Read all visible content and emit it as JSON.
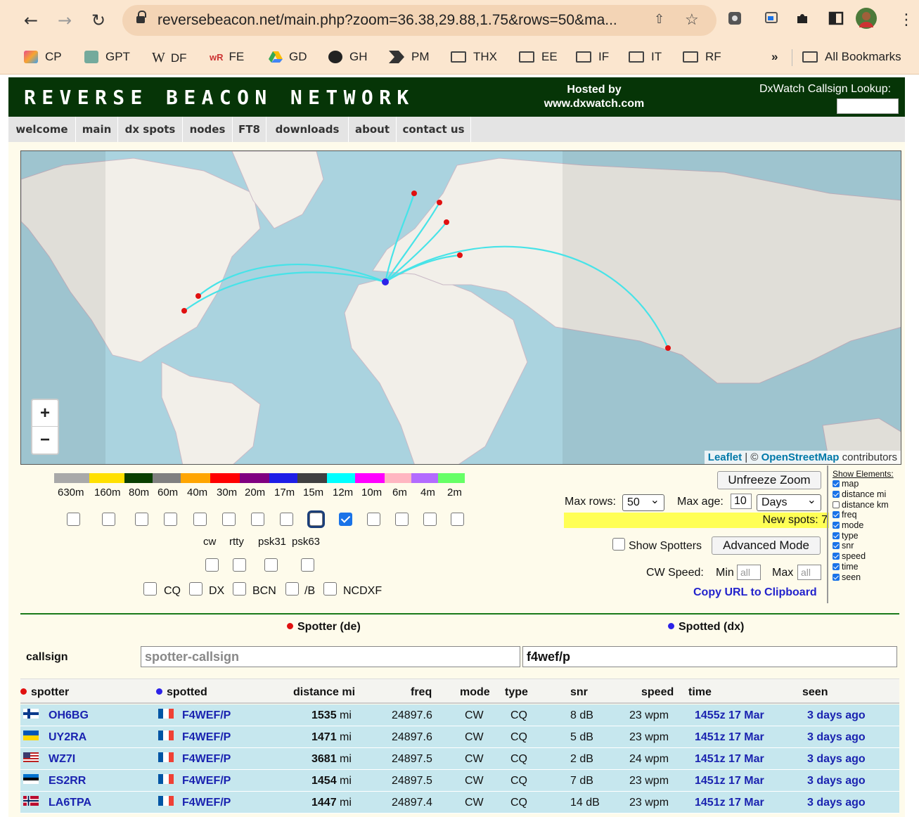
{
  "browser": {
    "url": "reversebeacon.net/main.php?zoom=36.38,29.88,1.75&rows=50&ma...",
    "bookmarks": [
      "CP",
      "GPT",
      "DF",
      "FE",
      "GD",
      "GH",
      "PM",
      "THX",
      "EE",
      "IF",
      "IT",
      "RF"
    ],
    "all_bookmarks": "All Bookmarks",
    "overflow": "»"
  },
  "banner": {
    "logo": "REVERSE BEACON NETWORK",
    "hosted_line1": "Hosted by",
    "hosted_line2": "www.dxwatch.com",
    "lookup_label": "DxWatch Callsign Lookup:"
  },
  "nav": [
    "welcome",
    "main",
    "dx spots",
    "nodes",
    "FT8",
    "downloads",
    "about",
    "contact us"
  ],
  "map": {
    "zoom_in": "+",
    "zoom_out": "−",
    "attrib_leaflet": "Leaflet",
    "attrib_sep": " | © ",
    "attrib_osm": "OpenStreetMap",
    "attrib_tail": " contributors"
  },
  "bands": {
    "labels": [
      "630m",
      "160m",
      "80m",
      "60m",
      "40m",
      "30m",
      "20m",
      "17m",
      "15m",
      "12m",
      "10m",
      "6m",
      "4m",
      "2m"
    ],
    "colors": [
      "#a9a9a9",
      "#ffe000",
      "#093f00",
      "#808080",
      "#ffa500",
      "#ff0000",
      "#800080",
      "#1e1ee6",
      "#404040",
      "#00ffff",
      "#ff00ff",
      "#ffb6c1",
      "#b36bff",
      "#66ff66"
    ],
    "checked": [
      false,
      false,
      false,
      false,
      false,
      false,
      false,
      false,
      false,
      true,
      false,
      false,
      false,
      false
    ]
  },
  "modes": [
    "cw",
    "rtty",
    "psk31",
    "psk63"
  ],
  "spot_types": [
    "CQ",
    "DX",
    "BCN",
    "/B",
    "NCDXF"
  ],
  "controls": {
    "unfreeze": "Unfreeze Zoom",
    "max_rows_label": "Max rows:",
    "max_rows": "50",
    "max_age_label": "Max age:",
    "max_age": "10",
    "max_age_unit": "Days",
    "new_spots": "New spots: 7",
    "show_spotters": "Show Spotters",
    "advanced": "Advanced Mode",
    "cw_speed": "CW Speed:",
    "min": "Min",
    "max": "Max",
    "all": "all",
    "copy_url": "Copy URL to Clipboard"
  },
  "show_elements": {
    "title": "Show Elements:",
    "items": [
      {
        "label": "map",
        "on": true
      },
      {
        "label": "distance mi",
        "on": true
      },
      {
        "label": "distance km",
        "on": false
      },
      {
        "label": "freq",
        "on": true
      },
      {
        "label": "mode",
        "on": true
      },
      {
        "label": "type",
        "on": true
      },
      {
        "label": "snr",
        "on": true
      },
      {
        "label": "speed",
        "on": true
      },
      {
        "label": "time",
        "on": true
      },
      {
        "label": "seen",
        "on": true
      }
    ]
  },
  "filter": {
    "spotter_head": "Spotter (de)",
    "spotted_head": "Spotted (dx)",
    "callsign_label": "callsign",
    "spotter_placeholder": "spotter-callsign",
    "spotted_value": "f4wef/p"
  },
  "table": {
    "headers": [
      "spotter",
      "spotted",
      "distance mi",
      "freq",
      "mode",
      "type",
      "snr",
      "speed",
      "time",
      "seen"
    ],
    "rows": [
      {
        "spotter": "OH6BG",
        "flag": "fi",
        "spotted": "F4WEF/P",
        "dist": "1535",
        "unit": "mi",
        "freq": "24897.6",
        "mode": "CW",
        "type": "CQ",
        "snr": "8 dB",
        "speed": "23 wpm",
        "time": "1455z 17 Mar",
        "seen": "3 days ago"
      },
      {
        "spotter": "UY2RA",
        "flag": "ua",
        "spotted": "F4WEF/P",
        "dist": "1471",
        "unit": "mi",
        "freq": "24897.6",
        "mode": "CW",
        "type": "CQ",
        "snr": "5 dB",
        "speed": "23 wpm",
        "time": "1451z 17 Mar",
        "seen": "3 days ago"
      },
      {
        "spotter": "WZ7I",
        "flag": "us",
        "spotted": "F4WEF/P",
        "dist": "3681",
        "unit": "mi",
        "freq": "24897.5",
        "mode": "CW",
        "type": "CQ",
        "snr": "2 dB",
        "speed": "24 wpm",
        "time": "1451z 17 Mar",
        "seen": "3 days ago"
      },
      {
        "spotter": "ES2RR",
        "flag": "ee",
        "spotted": "F4WEF/P",
        "dist": "1454",
        "unit": "mi",
        "freq": "24897.5",
        "mode": "CW",
        "type": "CQ",
        "snr": "7 dB",
        "speed": "23 wpm",
        "time": "1451z 17 Mar",
        "seen": "3 days ago"
      },
      {
        "spotter": "LA6TPA",
        "flag": "no",
        "spotted": "F4WEF/P",
        "dist": "1447",
        "unit": "mi",
        "freq": "24897.4",
        "mode": "CW",
        "type": "CQ",
        "snr": "14 dB",
        "speed": "23 wpm",
        "time": "1451z 17 Mar",
        "seen": "3 days ago"
      }
    ]
  }
}
